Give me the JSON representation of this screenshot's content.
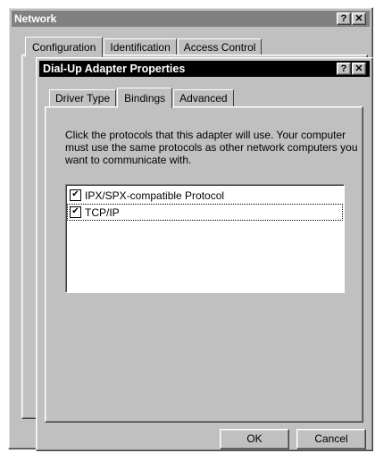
{
  "network": {
    "title": "Network",
    "help_glyph": "?",
    "close_glyph": "✕",
    "tabs": [
      "Configuration",
      "Identification",
      "Access Control"
    ]
  },
  "dialog": {
    "title": "Dial-Up Adapter Properties",
    "help_glyph": "?",
    "close_glyph": "✕",
    "tabs": [
      "Driver Type",
      "Bindings",
      "Advanced"
    ],
    "active_tab": "Bindings",
    "description": "Click the protocols that this adapter will use. Your computer must use the same protocols as other network computers you want to communicate with.",
    "protocols": [
      {
        "label": "IPX/SPX-compatible Protocol",
        "checked": true
      },
      {
        "label": "TCP/IP",
        "checked": true
      }
    ],
    "check_glyph": "✔",
    "ok_label": "OK",
    "cancel_label": "Cancel"
  },
  "colors": {
    "face": "#c0c0c0",
    "inactive_title": "#808080",
    "active_title": "#000000"
  }
}
